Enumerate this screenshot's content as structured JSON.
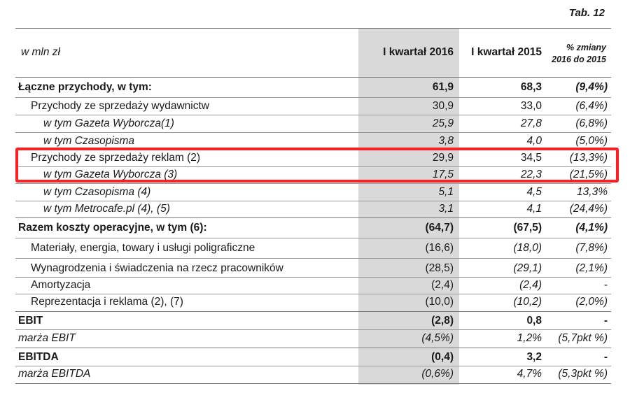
{
  "tab_label": "Tab. 12",
  "header": {
    "unit": "w mln zł",
    "col_a": "I kwartał 2016",
    "col_b": "I kwartał 2015",
    "col_c_line1": "% zmiany",
    "col_c_line2": "2016 do 2015"
  },
  "rows": [
    {
      "label": "Łączne przychody, w tym:",
      "a": "61,9",
      "b": "68,3",
      "c": "(9,4%)"
    },
    {
      "label": "Przychody ze sprzedaży wydawnictw",
      "a": "30,9",
      "b": "33,0",
      "c": "(6,4%)"
    },
    {
      "label": "w tym Gazeta Wyborcza(1)",
      "a": "25,9",
      "b": "27,8",
      "c": "(6,8%)"
    },
    {
      "label": "w tym Czasopisma",
      "a": "3,8",
      "b": "4,0",
      "c": "(5,0%)"
    },
    {
      "label": "Przychody ze sprzedaży reklam (2)",
      "a": "29,9",
      "b": "34,5",
      "c": "(13,3%)"
    },
    {
      "label": "w tym Gazeta Wyborcza (3)",
      "a": "17,5",
      "b": "22,3",
      "c": "(21,5%)"
    },
    {
      "label": "w tym Czasopisma (4)",
      "a": "5,1",
      "b": "4,5",
      "c": "13,3%"
    },
    {
      "label": "w tym Metrocafe.pl (4), (5)",
      "a": "3,1",
      "b": "4,1",
      "c": "(24,4%)"
    },
    {
      "label": "Razem koszty operacyjne, w tym (6):",
      "a": "(64,7)",
      "b": "(67,5)",
      "c": "(4,1%)"
    },
    {
      "label": "Materiały, energia, towary i usługi poligraficzne",
      "a": "(16,6)",
      "b": "(18,0)",
      "c": "(7,8%)"
    },
    {
      "label": "Wynagrodzenia i świadczenia na rzecz pracowników",
      "a": "(28,5)",
      "b": "(29,1)",
      "c": "(2,1%)"
    },
    {
      "label": "Amortyzacja",
      "a": "(2,4)",
      "b": "(2,4)",
      "c": "-"
    },
    {
      "label": "Reprezentacja i reklama (2), (7)",
      "a": "(10,0)",
      "b": "(10,2)",
      "c": "(2,0%)"
    },
    {
      "label": "EBIT",
      "a": "(2,8)",
      "b": "0,8",
      "c": "-"
    },
    {
      "label": "marża EBIT",
      "a": "(4,5%)",
      "b": "1,2%",
      "c": "(5,7pkt %)"
    },
    {
      "label": "EBITDA",
      "a": "(0,4)",
      "b": "3,2",
      "c": "-"
    },
    {
      "label": "marża EBITDA",
      "a": "(0,6%)",
      "b": "4,7%",
      "c": "(5,3pkt %)"
    }
  ]
}
